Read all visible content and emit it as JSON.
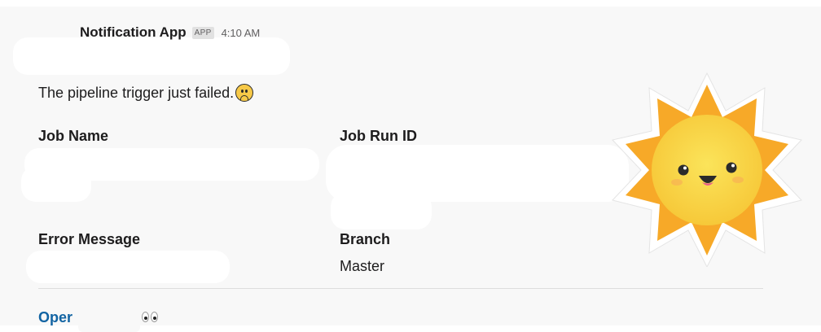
{
  "header": {
    "app_name": "Notification App",
    "app_badge": "APP",
    "time": "4:10 AM"
  },
  "message": {
    "text": "The pipeline trigger just failed.",
    "emoji_icon": "slightly-frowning-face-icon"
  },
  "fields": {
    "job_name": {
      "label": "Job Name",
      "value": ""
    },
    "job_run_id": {
      "label": "Job Run ID",
      "value": ""
    },
    "error_message": {
      "label": "Error Message",
      "value": ""
    },
    "branch": {
      "label": "Branch",
      "value": "Master"
    }
  },
  "link": {
    "text": "Oper",
    "emoji_icon": "eyes-icon",
    "color": "#1264a3"
  },
  "sticker": {
    "icon": "smiling-sun-sticker-icon",
    "colors": {
      "outer": "#f7a928",
      "inner": "#f7d94a"
    }
  },
  "colors": {
    "background": "#f8f8f8",
    "text": "#1d1c1d",
    "muted": "#616061"
  }
}
